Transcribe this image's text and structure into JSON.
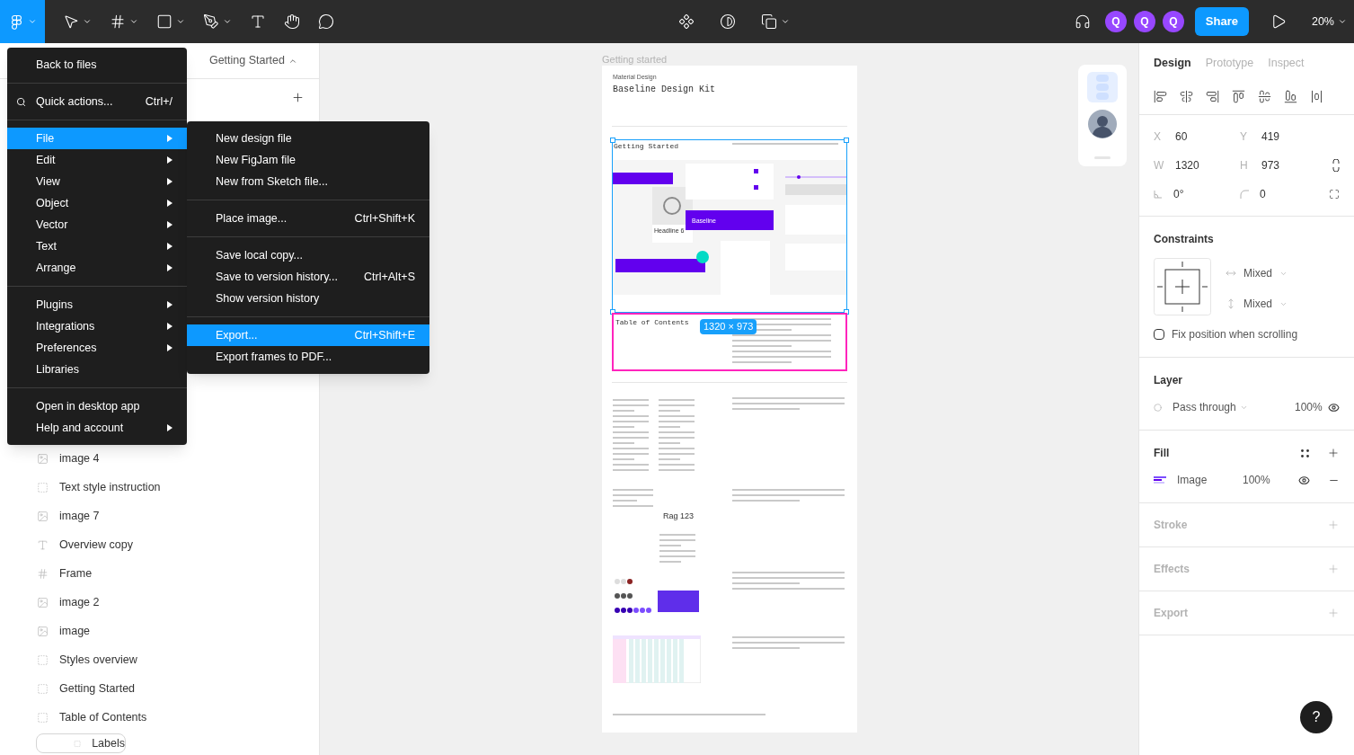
{
  "toolbar": {
    "avatars": [
      "Q",
      "Q",
      "Q"
    ],
    "share": "Share",
    "zoom": "20%"
  },
  "left_panel": {
    "page": "Getting Started",
    "layers": [
      {
        "kind": "image",
        "name": "image 4",
        "hovered": false
      },
      {
        "kind": "group",
        "name": "Text style instruction",
        "hovered": false
      },
      {
        "kind": "image",
        "name": "image 7",
        "hovered": false
      },
      {
        "kind": "text",
        "name": "Overview copy",
        "hovered": false
      },
      {
        "kind": "frame",
        "name": "Frame",
        "hovered": false
      },
      {
        "kind": "image",
        "name": "image 2",
        "hovered": false
      },
      {
        "kind": "image",
        "name": "image",
        "hovered": false
      },
      {
        "kind": "group",
        "name": "Styles overview",
        "hovered": false
      },
      {
        "kind": "group",
        "name": "Getting Started",
        "hovered": false
      },
      {
        "kind": "group",
        "name": "Table of Contents",
        "hovered": false
      },
      {
        "kind": "group",
        "name": "Labels",
        "hovered": true
      }
    ]
  },
  "main_menu": [
    {
      "kind": "item",
      "label": "Back to files",
      "selected": false,
      "submenu": false
    },
    {
      "kind": "divider"
    },
    {
      "kind": "search",
      "label": "Quick actions...",
      "shortcut": "Ctrl+/",
      "selected": false,
      "submenu": false
    },
    {
      "kind": "divider"
    },
    {
      "kind": "item",
      "label": "File",
      "selected": true,
      "submenu": true
    },
    {
      "kind": "item",
      "label": "Edit",
      "selected": false,
      "submenu": true
    },
    {
      "kind": "item",
      "label": "View",
      "selected": false,
      "submenu": true
    },
    {
      "kind": "item",
      "label": "Object",
      "selected": false,
      "submenu": true
    },
    {
      "kind": "item",
      "label": "Vector",
      "selected": false,
      "submenu": true
    },
    {
      "kind": "item",
      "label": "Text",
      "selected": false,
      "submenu": true
    },
    {
      "kind": "item",
      "label": "Arrange",
      "selected": false,
      "submenu": true
    },
    {
      "kind": "divider"
    },
    {
      "kind": "item",
      "label": "Plugins",
      "selected": false,
      "submenu": true
    },
    {
      "kind": "item",
      "label": "Integrations",
      "selected": false,
      "submenu": true
    },
    {
      "kind": "item",
      "label": "Preferences",
      "selected": false,
      "submenu": true
    },
    {
      "kind": "item",
      "label": "Libraries",
      "selected": false,
      "submenu": false
    },
    {
      "kind": "divider"
    },
    {
      "kind": "item",
      "label": "Open in desktop app",
      "selected": false,
      "submenu": false
    },
    {
      "kind": "item",
      "label": "Help and account",
      "selected": false,
      "submenu": true
    }
  ],
  "file_menu": [
    {
      "kind": "item",
      "label": "New design file",
      "selected": false
    },
    {
      "kind": "item",
      "label": "New FigJam file",
      "selected": false
    },
    {
      "kind": "item",
      "label": "New from Sketch file...",
      "selected": false
    },
    {
      "kind": "divider"
    },
    {
      "kind": "item",
      "label": "Place image...",
      "shortcut": "Ctrl+Shift+K",
      "selected": false
    },
    {
      "kind": "divider"
    },
    {
      "kind": "item",
      "label": "Save local copy...",
      "selected": false
    },
    {
      "kind": "item",
      "label": "Save to version history...",
      "shortcut": "Ctrl+Alt+S",
      "selected": false
    },
    {
      "kind": "item",
      "label": "Show version history",
      "selected": false
    },
    {
      "kind": "divider"
    },
    {
      "kind": "item",
      "label": "Export...",
      "shortcut": "Ctrl+Shift+E",
      "selected": true
    },
    {
      "kind": "item",
      "label": "Export frames to PDF...",
      "selected": false
    }
  ],
  "canvas": {
    "frame_label": "Getting started",
    "kicker": "Material Design",
    "title": "Baseline Design Kit",
    "section_1": "Getting Started",
    "section_2": "Table of Contents",
    "size_badge": "1320 × 973",
    "card_title": "Headline 6",
    "app_bar": "Baseline",
    "sample": "Rag 123"
  },
  "right_panel": {
    "tabs": [
      {
        "label": "Design",
        "selected": true
      },
      {
        "label": "Prototype",
        "selected": false
      },
      {
        "label": "Inspect",
        "selected": false
      }
    ],
    "geometry": [
      [
        {
          "kind": "label",
          "label": "X",
          "value": "60"
        },
        {
          "kind": "label",
          "label": "Y",
          "value": "419"
        }
      ],
      [
        {
          "kind": "label",
          "label": "W",
          "value": "1320"
        },
        {
          "kind": "label",
          "label": "H",
          "value": "973"
        }
      ],
      [
        {
          "kind": "rotation",
          "value": "0°"
        },
        {
          "kind": "radius",
          "value": "0"
        }
      ]
    ],
    "constraints": {
      "title": "Constraints",
      "horizontal": "Mixed",
      "vertical": "Mixed",
      "fix_label": "Fix position when scrolling",
      "fix_checked": false
    },
    "layer": {
      "title": "Layer",
      "blend": "Pass through",
      "opacity": "100%"
    },
    "fill": {
      "title": "Fill",
      "items": [
        {
          "label": "Image",
          "opacity": "100%"
        }
      ]
    },
    "empty_sections": [
      "Stroke",
      "Effects",
      "Export"
    ],
    "help": "?"
  }
}
